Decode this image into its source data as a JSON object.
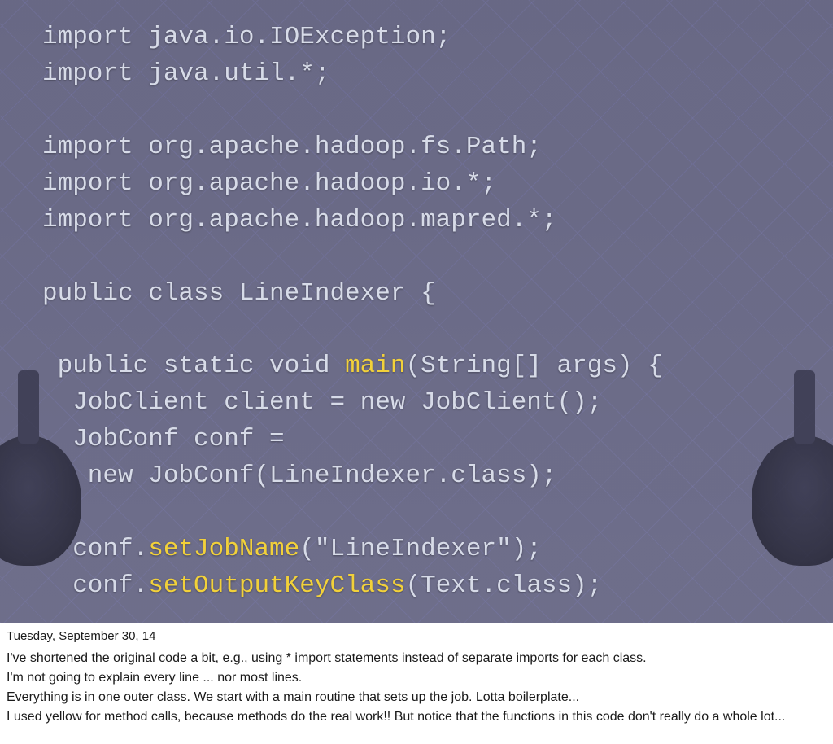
{
  "slide": {
    "code": {
      "l1": "import java.io.IOException;",
      "l2": "import java.util.*;",
      "l3": "",
      "l4": "import org.apache.hadoop.fs.Path;",
      "l5": "import org.apache.hadoop.io.*;",
      "l6": "import org.apache.hadoop.mapred.*;",
      "l7": "",
      "l8": "public class LineIndexer {",
      "l9": "",
      "l10a": " public static void ",
      "l10b": "main",
      "l10c": "(String[] args) {",
      "l11": "  JobClient client = new JobClient();",
      "l12": "  JobConf conf = ",
      "l13": "   new JobConf(LineIndexer.class);",
      "l14": "",
      "l15a": "  conf.",
      "l15b": "setJobName",
      "l15c": "(\"LineIndexer\");",
      "l16a": "  conf.",
      "l16b": "setOutputKeyClass",
      "l16c": "(Text.class);"
    }
  },
  "notes": {
    "date": "Tuesday, September 30, 14",
    "p1": "I've shortened the original code a bit, e.g., using * import statements instead of separate imports for each class.",
    "p2": "I'm not going to explain every line ... nor most lines.",
    "p3": "Everything is in one outer class. We start with a main routine that sets up the job. Lotta boilerplate...",
    "p4": "I used yellow for method calls, because methods do the real work!! But notice that the functions in this code don't really do a whole lot..."
  }
}
